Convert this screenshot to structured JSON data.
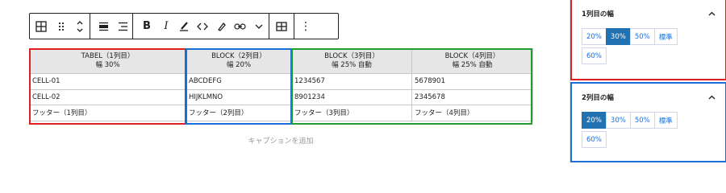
{
  "toolbar": {
    "bold": "B",
    "italic": "I",
    "more": "⋮"
  },
  "table": {
    "headers": [
      {
        "line1": "TABEL（1列目）",
        "line2": "幅 30%"
      },
      {
        "line1": "BLOCK（2列目）",
        "line2": "幅 20%"
      },
      {
        "line1": "BLOCK（3列目）",
        "line2": "幅 25% 自動"
      },
      {
        "line1": "BLOCK（4列目）",
        "line2": "幅 25% 自動"
      }
    ],
    "rows": [
      [
        "CELL-01",
        "ABCDEFG",
        "1234567",
        "5678901"
      ],
      [
        "CELL-02",
        "HIJKLMNO",
        "8901234",
        "2345678"
      ],
      [
        "フッター（1列目）",
        "フッター（2列目）",
        "フッター（3列目）",
        "フッター（4列目）"
      ]
    ],
    "caption_placeholder": "キャプションを追加"
  },
  "sidebar": {
    "panel1": {
      "title": "1列目の幅",
      "options": [
        "20%",
        "30%",
        "50%",
        "標準",
        "60%"
      ],
      "selected": "30%"
    },
    "panel2": {
      "title": "2列目の幅",
      "options": [
        "20%",
        "30%",
        "50%",
        "標準",
        "60%"
      ],
      "selected": "20%"
    }
  },
  "colors": {
    "highlight_col1": "#e02020",
    "highlight_col2": "#1c6fd6",
    "highlight_col34": "#1f9d2e",
    "active_option": "#2271b1"
  }
}
